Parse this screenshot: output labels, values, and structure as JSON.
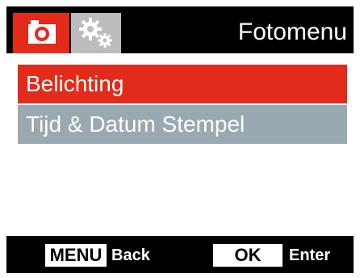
{
  "header": {
    "title": "Fotomenu",
    "tabs": [
      {
        "icon": "camera-icon",
        "active": true
      },
      {
        "icon": "gears-icon",
        "active": false
      }
    ]
  },
  "menu": {
    "items": [
      {
        "label": "Belichting",
        "selected": true
      },
      {
        "label": "Tijd & Datum Stempel",
        "selected": false
      }
    ]
  },
  "footer": {
    "menu_key": "MENU",
    "menu_action": "Back",
    "ok_key": "OK",
    "ok_action": "Enter"
  },
  "colors": {
    "accent": "#e22b1b",
    "secondary_item": "#9aa9b1",
    "inactive_tab": "#bcbcbc",
    "frame": "#000000"
  }
}
